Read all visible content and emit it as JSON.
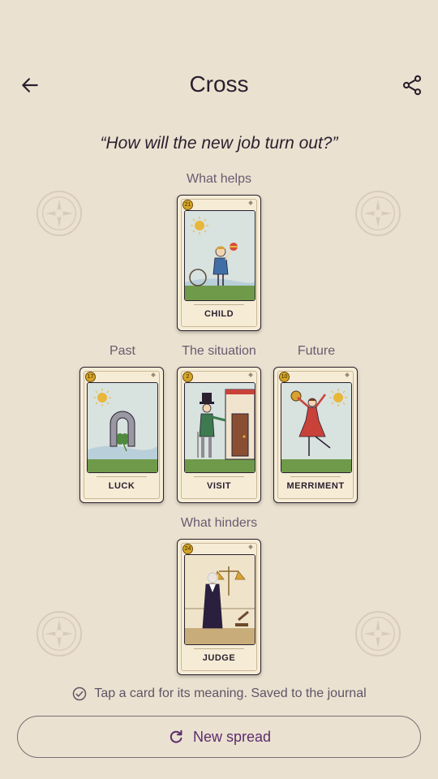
{
  "header": {
    "title": "Cross",
    "back_icon": "arrow-left-icon",
    "share_icon": "share-icon"
  },
  "question": "“How will the new job turn out?”",
  "positions": {
    "top": "What helps",
    "left": "Past",
    "center": "The situation",
    "right": "Future",
    "bottom": "What hinders"
  },
  "cards": {
    "top": {
      "number": "21",
      "name": "CHILD"
    },
    "left": {
      "number": "17",
      "name": "LUCK"
    },
    "center": {
      "number": "2",
      "name": "VISIT"
    },
    "right": {
      "number": "10",
      "name": "MERRIMENT"
    },
    "bottom": {
      "number": "24",
      "name": "JUDGE"
    }
  },
  "hint": "Tap a card for its meaning. Saved to the journal",
  "new_spread_label": "New spread",
  "colors": {
    "background": "#ebe1d0",
    "card": "#f6ecd6",
    "accent": "#5b2d6e",
    "label": "#6b5a70"
  }
}
